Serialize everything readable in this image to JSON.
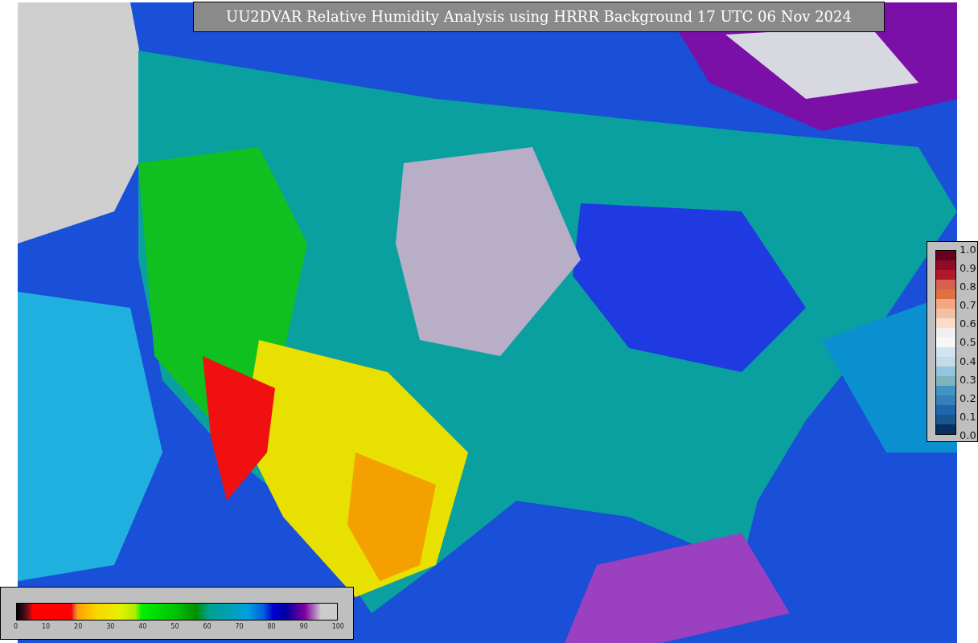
{
  "title": "UU2DVAR Relative Humidity Analysis using HRRR Background 17 UTC 06 Nov 2024",
  "colorbars": [
    {
      "kind": "vertical",
      "ticks": [
        "1.0",
        "0.9",
        "0.8",
        "0.7",
        "0.6",
        "0.5",
        "0.4",
        "0.3",
        "0.2",
        "0.1",
        "0.0"
      ]
    },
    {
      "kind": "horizontal",
      "ticks": [
        "0",
        "10",
        "20",
        "30",
        "40",
        "50",
        "60",
        "70",
        "80",
        "90",
        "100"
      ]
    }
  ]
}
